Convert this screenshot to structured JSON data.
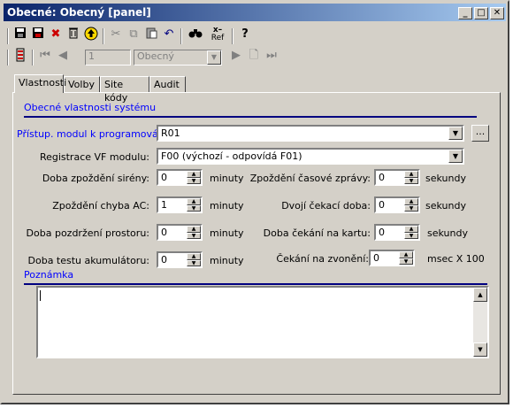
{
  "window": {
    "title": "Obecné: Obecný [panel]"
  },
  "title_buttons": {
    "minimize": "_",
    "maximize": "□",
    "close": "✕"
  },
  "toolbar1": {
    "icons": [
      "save-icon",
      "save-as-icon",
      "delete-icon",
      "trash-icon",
      "up-icon",
      "cut-icon",
      "copy-icon",
      "paste-icon",
      "undo-icon",
      "find-icon",
      "xref-icon",
      "help-icon"
    ],
    "xref_label": "Ref"
  },
  "toolbar2": {
    "record_number": "1",
    "record_type": "Obecný"
  },
  "tabs": [
    {
      "label": "Vlastnosti"
    },
    {
      "label": "Volby"
    },
    {
      "label": "Site kódy"
    },
    {
      "label": "Audit"
    }
  ],
  "section": {
    "title": "Obecné vlastnosti systému",
    "note_title": "Poznámka"
  },
  "fields": {
    "module_label": "Přístup. modul k programování:",
    "module_value": "R01",
    "ellipsis": "...",
    "rf_label": "Registrace VF modulu:",
    "rf_value": "F00 (výchozí - odpovídá  F01)",
    "siren_label": "Doba zpoždění sirény:",
    "siren_value": "0",
    "siren_unit": "minuty",
    "ac_label": "Zpoždění chyba AC:",
    "ac_value": "1",
    "ac_unit": "minuty",
    "space_label": "Doba pozdržení prostoru:",
    "space_value": "0",
    "space_unit": "minuty",
    "battery_label": "Doba testu akumulátoru:",
    "battery_value": "0",
    "battery_unit": "minuty",
    "msg_label": "Zpoždění časové zprávy:",
    "msg_value": "0",
    "msg_unit": "sekundy",
    "double_label": "Dvojí čekací doba:",
    "double_value": "0",
    "double_unit": "sekundy",
    "card_label": "Doba čekání na kartu:",
    "card_value": "0",
    "card_unit": "sekundy",
    "ring_label": "Čekání na zvonění:",
    "ring_value": "0",
    "ring_unit": "msec X 100"
  },
  "memo": {
    "value": ""
  }
}
